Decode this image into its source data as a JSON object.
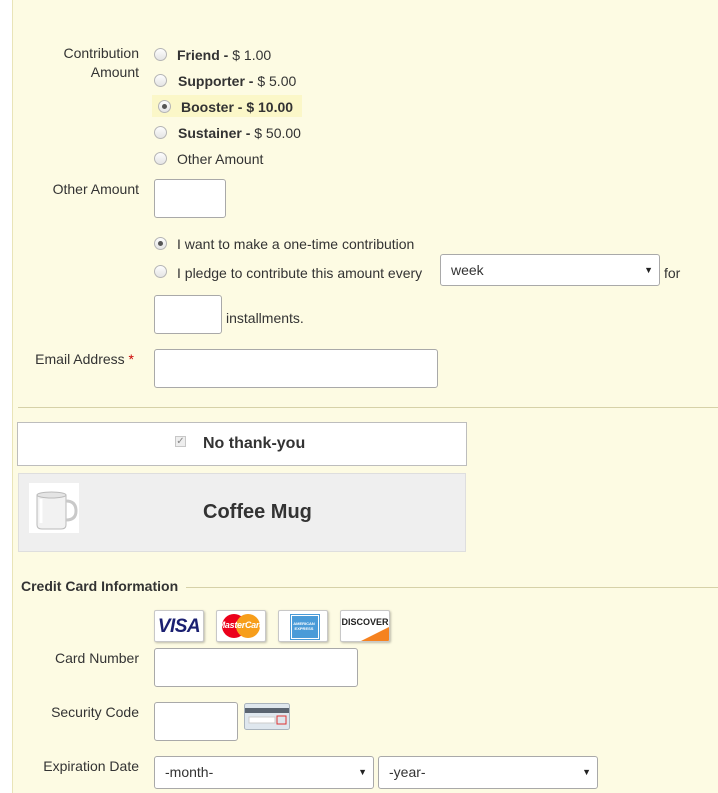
{
  "contribution": {
    "label": "Contribution Amount",
    "options": [
      {
        "name": "Friend -",
        "amount": "$ 1.00",
        "checked": false
      },
      {
        "name": "Supporter -",
        "amount": "$ 5.00",
        "checked": false
      },
      {
        "name": "Booster - $ 10.00",
        "amount": "",
        "checked": true
      },
      {
        "name": "Sustainer -",
        "amount": "$ 50.00",
        "checked": false
      },
      {
        "name": "Other Amount",
        "amount": "",
        "checked": false
      }
    ]
  },
  "other_amount": {
    "label": "Other Amount",
    "value": ""
  },
  "frequency": {
    "one_time": "I want to make a one-time contribution",
    "pledge": "I pledge to contribute this amount every",
    "period": "week",
    "for": "for",
    "installments_label": "installments.",
    "installments_value": ""
  },
  "email": {
    "label": "Email Address",
    "required": "*",
    "value": ""
  },
  "premium": {
    "no_thanks": "No thank-you",
    "mug": "Coffee Mug"
  },
  "credit_card": {
    "legend": "Credit Card Information",
    "cards": [
      "VISA",
      "MasterCard",
      "AMERICAN EXPRESS",
      "DISCOVER"
    ],
    "card_number_label": "Card Number",
    "card_number_value": "",
    "security_code_label": "Security Code",
    "security_code_value": "",
    "expiration_label": "Expiration Date",
    "month": "-month-",
    "year": "-year-"
  },
  "colors": {
    "background": "#fdfbe3",
    "required": "#cc0000",
    "visa_blue": "#1a1f71",
    "discover_orange": "#f58220"
  }
}
